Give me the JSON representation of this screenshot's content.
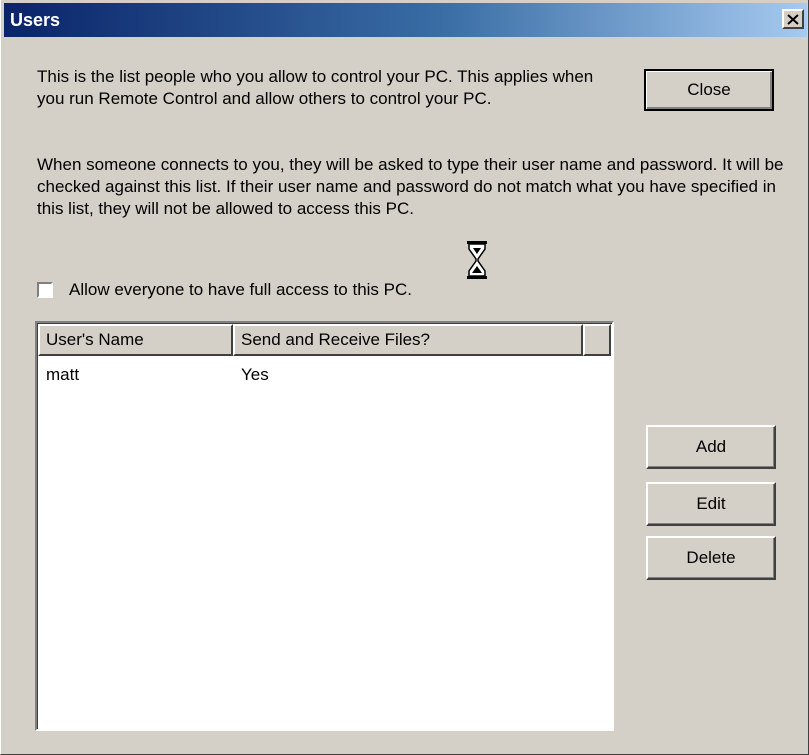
{
  "window": {
    "title": "Users"
  },
  "intro_text": "This is the list people who you allow to control your PC.  This applies when you run Remote Control and allow others to control your PC.",
  "detail_text": "When someone connects to you, they will be asked to type their user name and password.  It will be checked against this list.  If their user name and password do not match what you have specified in this list, they will not be allowed to access this PC.",
  "allow_everyone": {
    "label": "Allow everyone to have full access to this PC.",
    "checked": false
  },
  "buttons": {
    "close": "Close",
    "add": "Add",
    "edit": "Edit",
    "delete": "Delete"
  },
  "users_table": {
    "columns": [
      "User's Name",
      "Send and Receive Files?"
    ],
    "rows": [
      {
        "name": "matt",
        "send_receive": "Yes"
      }
    ]
  },
  "icons": {
    "title_close": "close-x-icon",
    "cursor": "hourglass-icon"
  },
  "colors": {
    "titlebar_start": "#0a246a",
    "titlebar_end": "#a6caf0",
    "face": "#d4d0c8"
  }
}
